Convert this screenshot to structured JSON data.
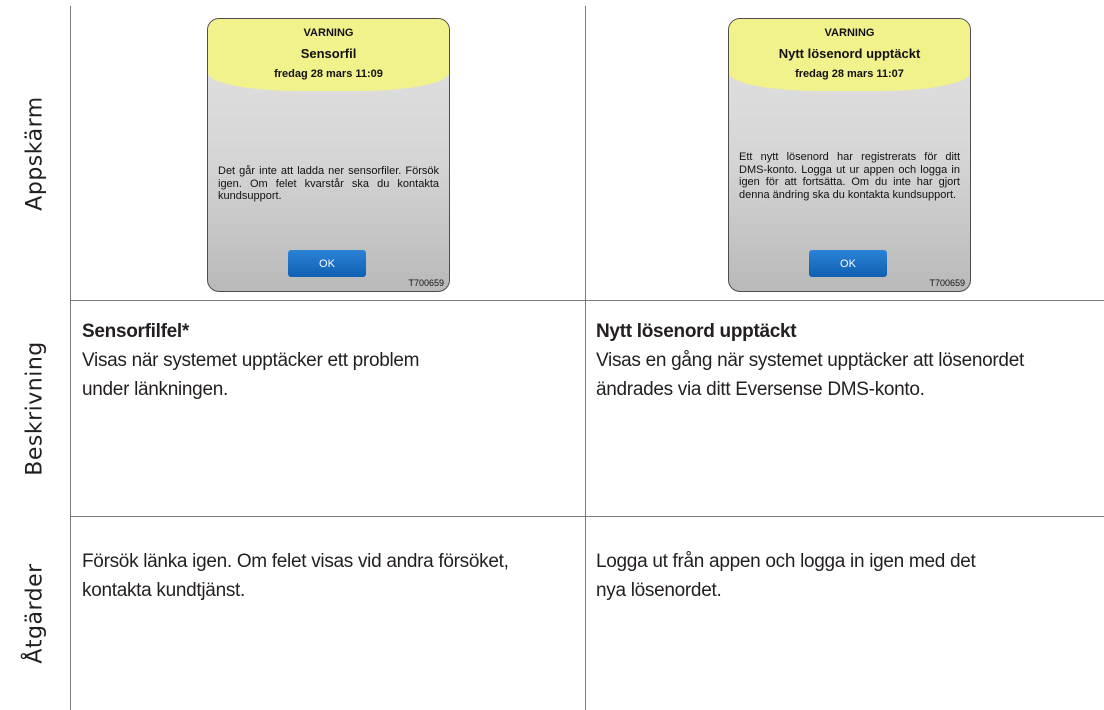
{
  "rows": {
    "screen_label": "Appskärm",
    "description_label": "Beskrivning",
    "actions_label": "Åtgärder"
  },
  "left": {
    "screen": {
      "warning": "VARNING",
      "title": "Sensorfil",
      "datetime": "fredag 28 mars 11:09",
      "message": "Det går inte att ladda ner sensorfiler. Försök igen. Om felet kvarstår ska du kontakta kundsupport.",
      "ok_label": "OK",
      "code": "T700659"
    },
    "description_title": "Sensorfilfel*",
    "description_line1": "Visas när systemet upptäcker ett problem",
    "description_line2": "under länkningen.",
    "action_line1": "Försök länka igen. Om felet visas vid andra försöket,",
    "action_line2": "kontakta kundtjänst."
  },
  "right": {
    "screen": {
      "warning": "VARNING",
      "title": "Nytt lösenord upptäckt",
      "datetime": "fredag 28 mars 11:07",
      "message": "Ett nytt lösenord har registrerats för ditt DMS-konto. Logga ut ur appen och logga in igen för att fortsätta. Om du inte har gjort denna ändring ska du kontakta kundsupport.",
      "ok_label": "OK",
      "code": "T700659"
    },
    "description_title": "Nytt lösenord upptäckt",
    "description_line1": "Visas en gång när systemet upptäcker att lösenordet",
    "description_line2": "ändrades via ditt Eversense DMS-konto.",
    "action_line1": "Logga ut från appen och logga in igen med det",
    "action_line2": "nya lösenordet."
  }
}
